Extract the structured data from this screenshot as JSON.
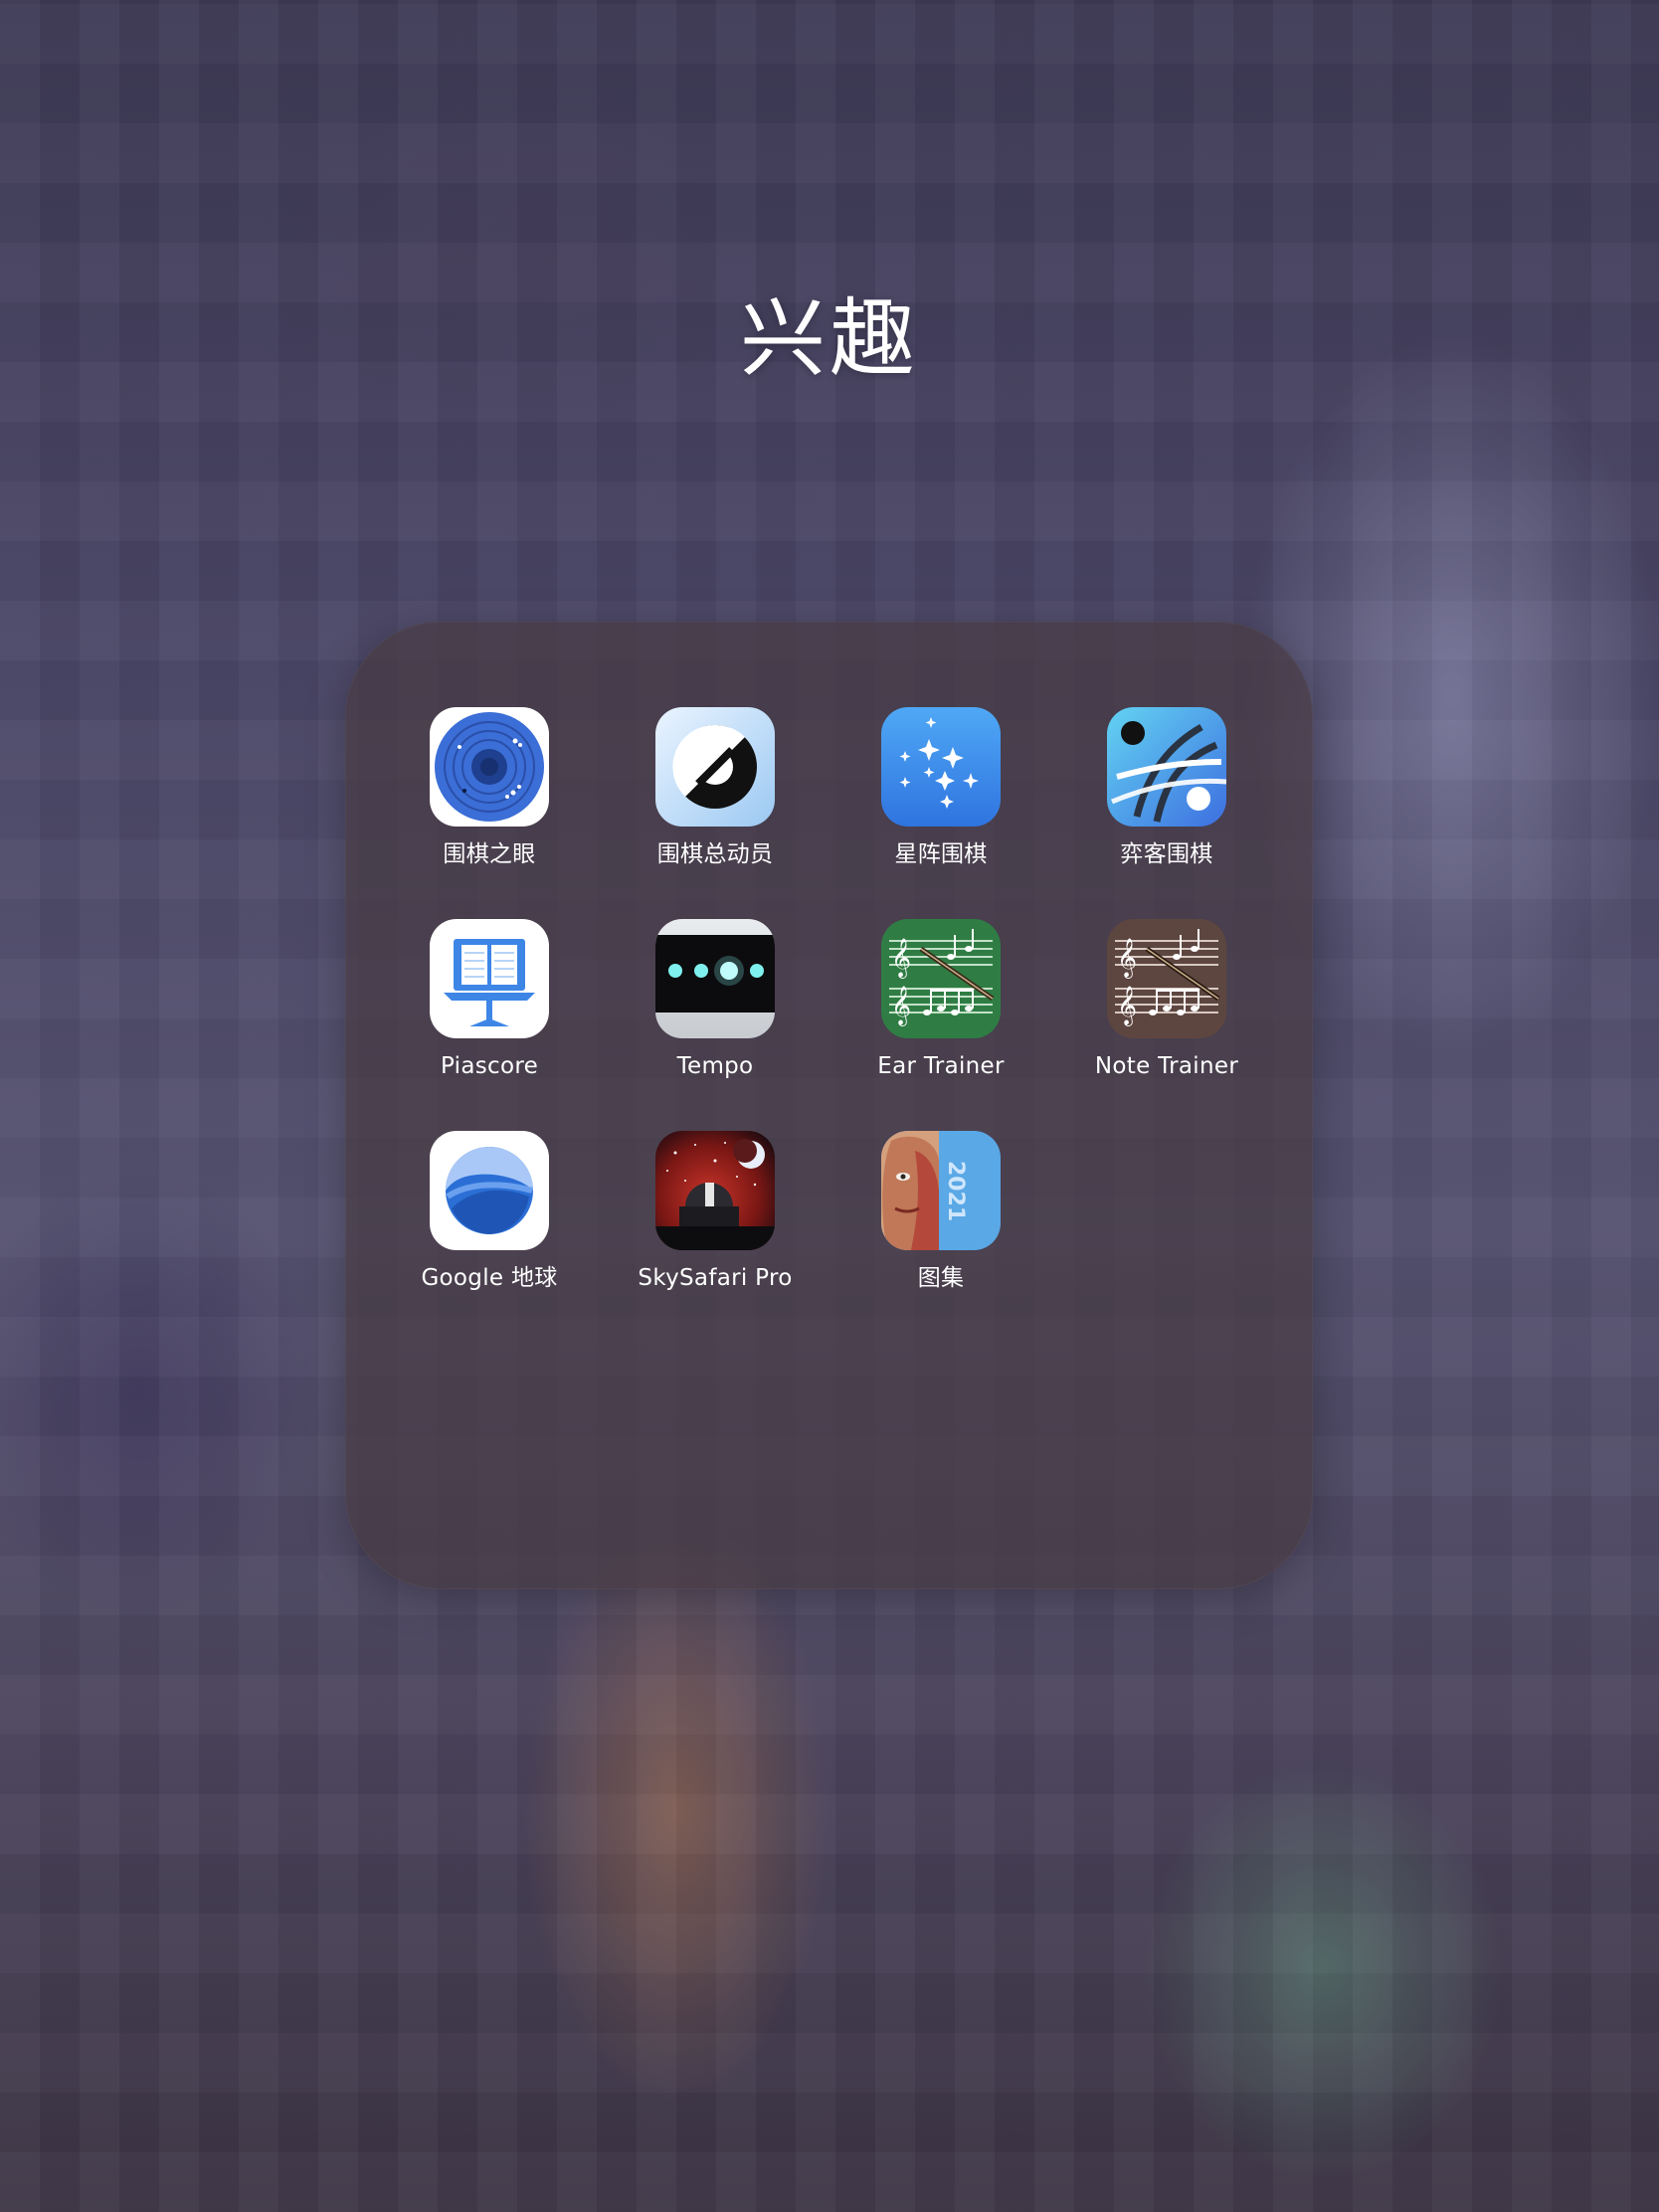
{
  "folder": {
    "title": "兴趣",
    "apps": [
      {
        "id": "weiqi-zhiyan",
        "label": "围棋之眼",
        "icon": "weiqi-eye-icon"
      },
      {
        "id": "weiqi-zongdongyuan",
        "label": "围棋总动员",
        "icon": "weiqi-mobilization-icon"
      },
      {
        "id": "xingzhen-weiqi",
        "label": "星阵围棋",
        "icon": "stars-go-icon"
      },
      {
        "id": "yike-weiqi",
        "label": "弈客围棋",
        "icon": "yike-go-icon"
      },
      {
        "id": "piascore",
        "label": "Piascore",
        "icon": "music-stand-icon"
      },
      {
        "id": "tempo",
        "label": "Tempo",
        "icon": "metronome-dots-icon"
      },
      {
        "id": "ear-trainer",
        "label": "Ear Trainer",
        "icon": "sheet-music-green-icon"
      },
      {
        "id": "note-trainer",
        "label": "Note Trainer",
        "icon": "sheet-music-brown-icon"
      },
      {
        "id": "google-earth",
        "label": "Google 地球",
        "icon": "google-earth-icon"
      },
      {
        "id": "skysafari",
        "label": "SkySafari Pro",
        "icon": "observatory-icon"
      },
      {
        "id": "atlas",
        "label": "图集",
        "icon": "anatomy-atlas-icon",
        "badge_text": "2021"
      }
    ]
  },
  "colors": {
    "panel": "#46393f",
    "label": "#ffffff"
  }
}
